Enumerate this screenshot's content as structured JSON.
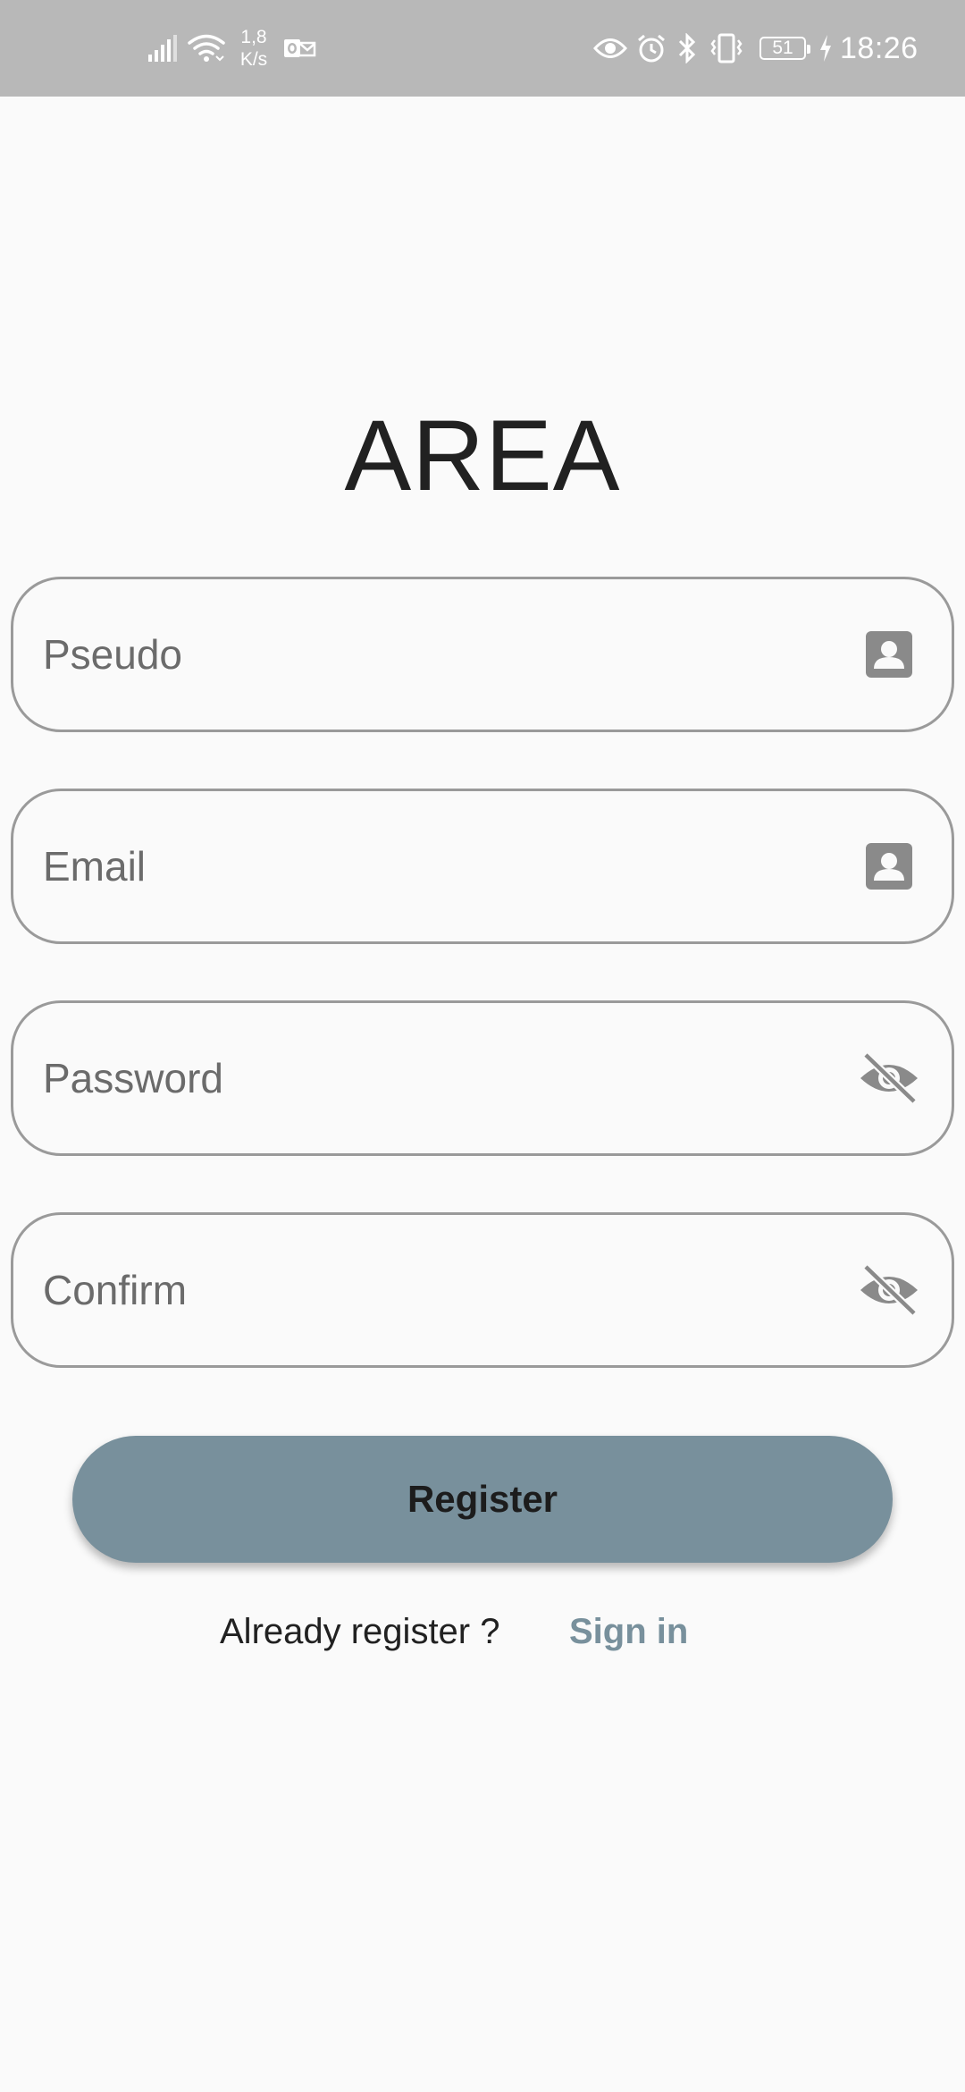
{
  "status_bar": {
    "net_speed_value": "1,8",
    "net_speed_unit": "K/s",
    "battery_level": "51",
    "time": "18:26",
    "icons": [
      "signal-icon",
      "wifi-icon",
      "outlook-icon",
      "eye-comfort-icon",
      "alarm-icon",
      "bluetooth-icon",
      "vibrate-icon",
      "battery-icon",
      "charging-icon"
    ]
  },
  "title": "AREA",
  "form": {
    "pseudo_placeholder": "Pseudo",
    "pseudo_value": "",
    "email_placeholder": "Email",
    "email_value": "",
    "password_placeholder": "Password",
    "password_value": "",
    "confirm_placeholder": "Confirm",
    "confirm_value": "",
    "pseudo_icon": "contact-icon",
    "email_icon": "contact-icon",
    "password_icon": "visibility-off-icon",
    "confirm_icon": "visibility-off-icon"
  },
  "register_button_label": "Register",
  "footer": {
    "already_text": "Already register ?",
    "sign_in_label": "Sign in"
  },
  "colors": {
    "accent": "#78909c",
    "status_bar_bg": "#b8b8b8",
    "page_bg": "#fafafa",
    "field_border": "#9a9a9a",
    "icon_grey": "#8a8a8a"
  }
}
